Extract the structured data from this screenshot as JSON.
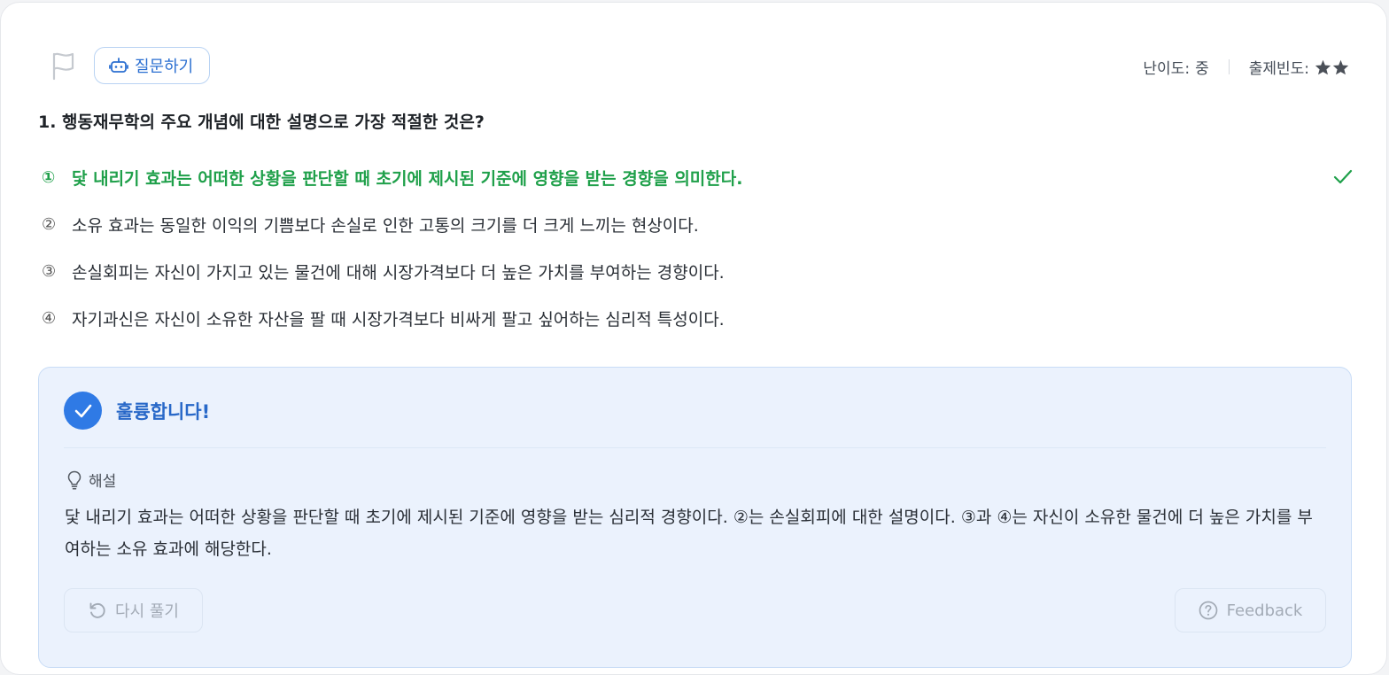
{
  "toolbar": {
    "flag_icon": "flag-icon",
    "ask_icon": "robot-icon",
    "ask_label": "질문하기"
  },
  "meta": {
    "difficulty_label": "난이도:",
    "difficulty_value": "중",
    "frequency_label": "출제빈도:",
    "frequency_stars": 2
  },
  "question": {
    "text": "1. 행동재무학의 주요 개념에 대한 설명으로 가장 적절한 것은?"
  },
  "options": [
    {
      "num": "①",
      "text": "닻 내리기 효과는 어떠한 상황을 판단할 때 초기에 제시된 기준에 영향을 받는 경향을 의미한다.",
      "correct": true
    },
    {
      "num": "②",
      "text": "소유 효과는 동일한 이익의 기쁨보다 손실로 인한 고통의 크기를 더 크게 느끼는 현상이다.",
      "correct": false
    },
    {
      "num": "③",
      "text": "손실회피는 자신이 가지고 있는 물건에 대해 시장가격보다 더 높은 가치를 부여하는 경향이다.",
      "correct": false
    },
    {
      "num": "④",
      "text": "자기과신은 자신이 소유한 자산을 팔 때 시장가격보다 비싸게 팔고 싶어하는 심리적 특성이다.",
      "correct": false
    }
  ],
  "result": {
    "title": "훌륭합니다!",
    "explanation_label": "해설",
    "explanation_text": "닻 내리기 효과는 어떠한 상황을 판단할 때 초기에 제시된 기준에 영향을 받는 심리적 경향이다. ②는 손실회피에 대한 설명이다. ③과 ④는 자신이 소유한 물건에 더 높은 가치를 부여하는 소유 효과에 해당한다.",
    "retry_label": "다시 풀기",
    "feedback_label": "Feedback"
  },
  "colors": {
    "correct": "#1fa04a",
    "accent": "#2f7ae5",
    "result_bg": "#ebf2fd"
  }
}
